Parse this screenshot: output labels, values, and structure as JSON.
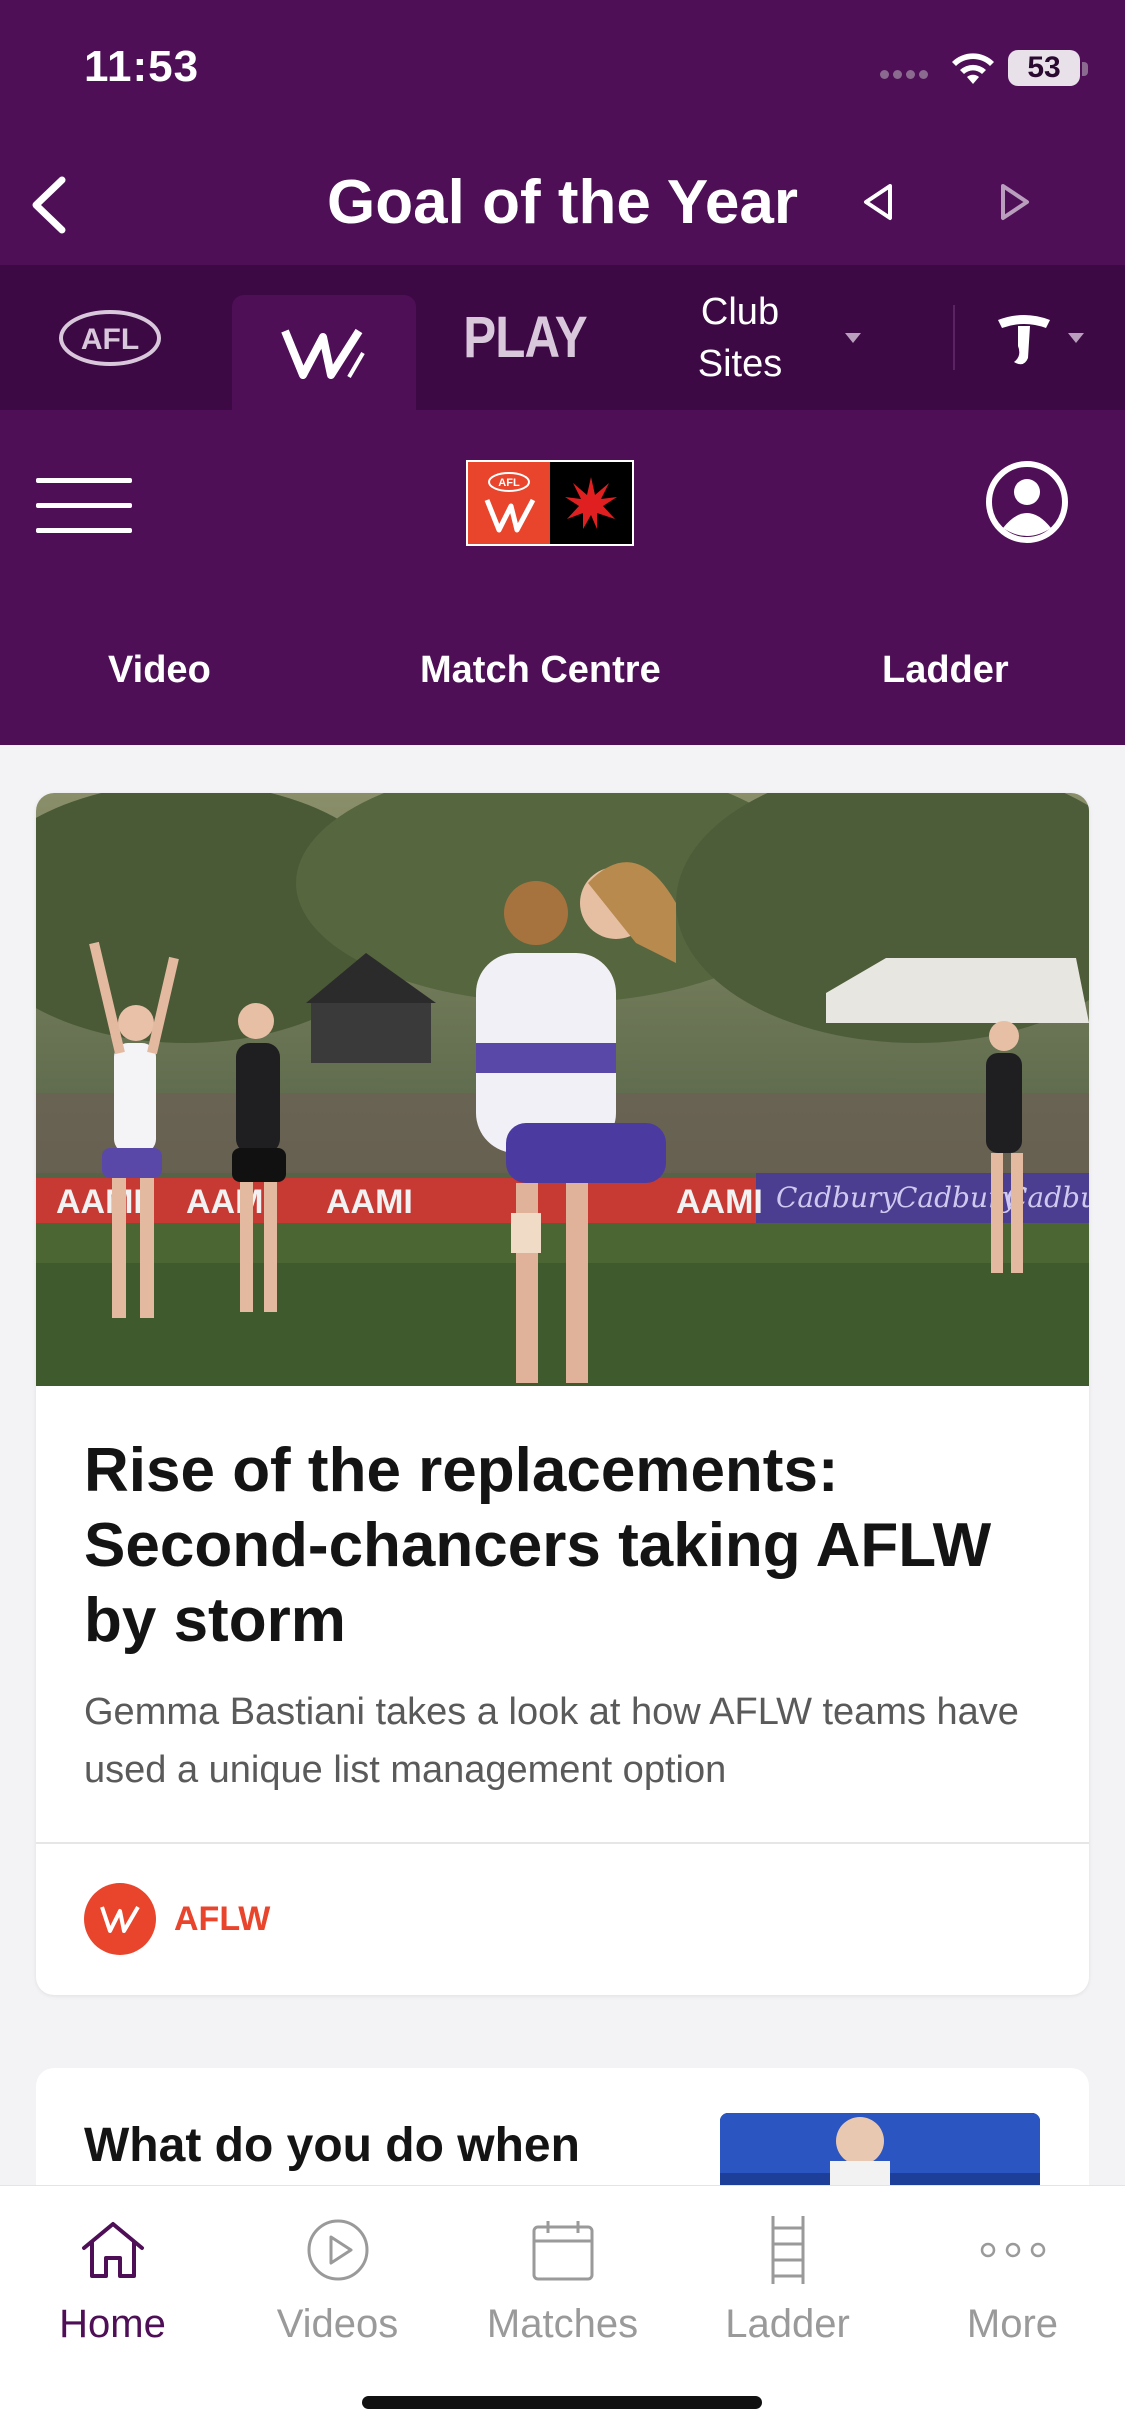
{
  "status_bar": {
    "time": "11:53",
    "battery": "53"
  },
  "header": {
    "title": "Goal of the Year"
  },
  "brand_bar": {
    "afl_label": "AFL",
    "play_label": "PLAY",
    "club_sites_line1": "Club",
    "club_sites_line2": "Sites"
  },
  "main_nav": {
    "logo_text": "AFL",
    "links": [
      "Video",
      "Match Centre",
      "Ladder"
    ]
  },
  "article": {
    "headline": "Rise of the replacements: Second-chancers taking AFLW by storm",
    "summary": "Gemma Bastiani takes a look at how AFLW teams have used a unique list management option",
    "tag": "AFLW",
    "photo_signage": [
      "AAMI",
      "AAMI",
      "AAMI",
      "AAMI",
      "Cadbury",
      "Cadbury",
      "Cadbury"
    ]
  },
  "next_article": {
    "headline": "What do you do when"
  },
  "tab_bar": {
    "tabs": [
      {
        "label": "Home",
        "icon": "home-icon",
        "active": true
      },
      {
        "label": "Videos",
        "icon": "play-circle-icon",
        "active": false
      },
      {
        "label": "Matches",
        "icon": "calendar-icon",
        "active": false
      },
      {
        "label": "Ladder",
        "icon": "ladder-icon",
        "active": false
      },
      {
        "label": "More",
        "icon": "more-dots-icon",
        "active": false
      }
    ]
  },
  "colors": {
    "brand_purple": "#4e0f57",
    "brand_purple_dark": "#3d0945",
    "aflw_orange": "#e8452c",
    "tab_inactive": "#9a9a9a"
  }
}
